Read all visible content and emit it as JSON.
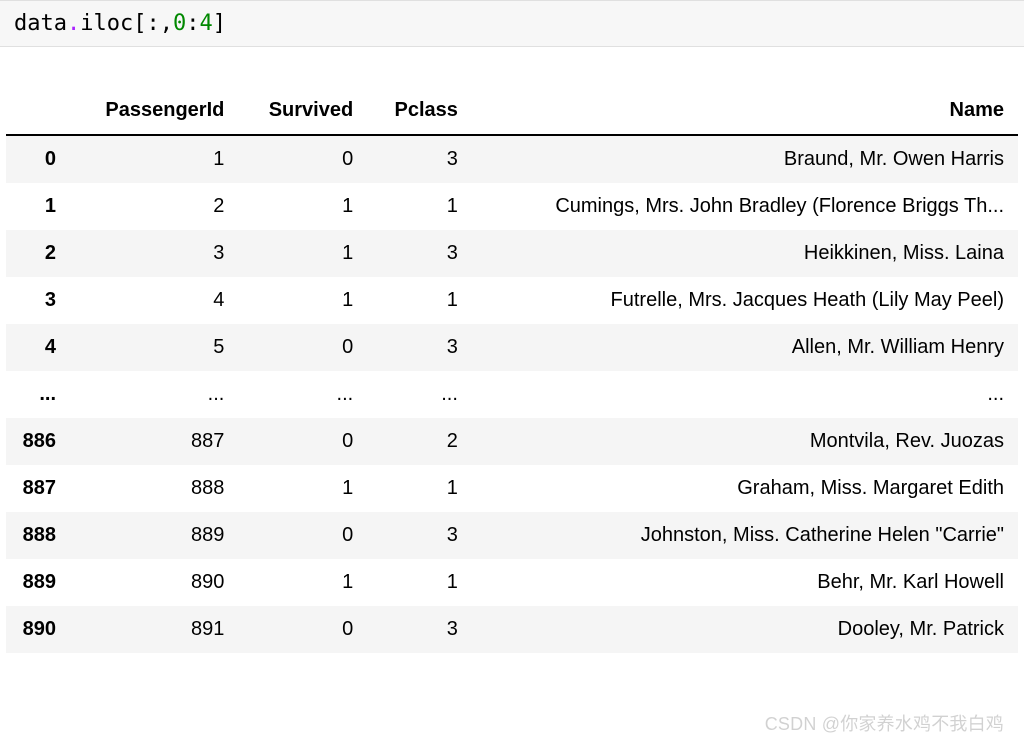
{
  "code": {
    "tokens": [
      {
        "cls": "id",
        "t": "data"
      },
      {
        "cls": "dot",
        "t": "."
      },
      {
        "cls": "attr",
        "t": "iloc"
      },
      {
        "cls": "brkt",
        "t": "["
      },
      {
        "cls": "colon",
        "t": ":"
      },
      {
        "cls": "comma",
        "t": ","
      },
      {
        "cls": "num",
        "t": "0"
      },
      {
        "cls": "colon",
        "t": ":"
      },
      {
        "cls": "num",
        "t": "4"
      },
      {
        "cls": "brkt",
        "t": "]"
      }
    ],
    "raw": "data.iloc[:,0:4]"
  },
  "table": {
    "columns": [
      "PassengerId",
      "Survived",
      "Pclass",
      "Name"
    ],
    "rows": [
      {
        "idx": "0",
        "PassengerId": "1",
        "Survived": "0",
        "Pclass": "3",
        "Name": "Braund, Mr. Owen Harris"
      },
      {
        "idx": "1",
        "PassengerId": "2",
        "Survived": "1",
        "Pclass": "1",
        "Name": "Cumings, Mrs. John Bradley (Florence Briggs Th..."
      },
      {
        "idx": "2",
        "PassengerId": "3",
        "Survived": "1",
        "Pclass": "3",
        "Name": "Heikkinen, Miss. Laina"
      },
      {
        "idx": "3",
        "PassengerId": "4",
        "Survived": "1",
        "Pclass": "1",
        "Name": "Futrelle, Mrs. Jacques Heath (Lily May Peel)"
      },
      {
        "idx": "4",
        "PassengerId": "5",
        "Survived": "0",
        "Pclass": "3",
        "Name": "Allen, Mr. William Henry"
      },
      {
        "idx": "...",
        "PassengerId": "...",
        "Survived": "...",
        "Pclass": "...",
        "Name": "..."
      },
      {
        "idx": "886",
        "PassengerId": "887",
        "Survived": "0",
        "Pclass": "2",
        "Name": "Montvila, Rev. Juozas"
      },
      {
        "idx": "887",
        "PassengerId": "888",
        "Survived": "1",
        "Pclass": "1",
        "Name": "Graham, Miss. Margaret Edith"
      },
      {
        "idx": "888",
        "PassengerId": "889",
        "Survived": "0",
        "Pclass": "3",
        "Name": "Johnston, Miss. Catherine Helen \"Carrie\""
      },
      {
        "idx": "889",
        "PassengerId": "890",
        "Survived": "1",
        "Pclass": "1",
        "Name": "Behr, Mr. Karl Howell"
      },
      {
        "idx": "890",
        "PassengerId": "891",
        "Survived": "0",
        "Pclass": "3",
        "Name": "Dooley, Mr. Patrick"
      }
    ]
  },
  "watermark": "CSDN @你家养水鸡不我白鸡"
}
